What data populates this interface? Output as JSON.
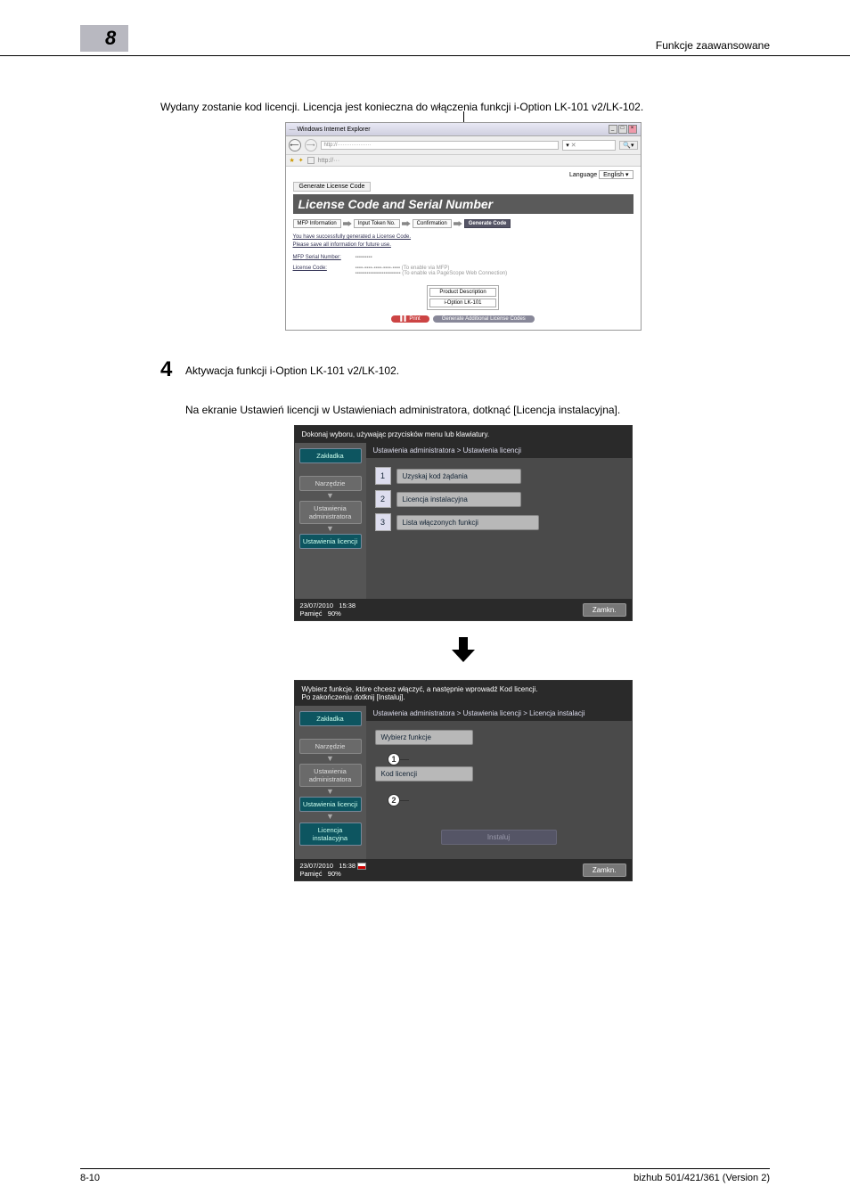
{
  "header": {
    "chapter_number": "8",
    "section_title": "Funkcje zaawansowane"
  },
  "intro": {
    "line": "Wydany zostanie kod licencji. Licencja jest konieczna do włączenia funkcji i-Option LK-101 v2/LK-102."
  },
  "browser": {
    "title_suffix": "Windows Internet Explorer",
    "language_label": "Language",
    "language_value": "English",
    "tab_label": "Generate License Code",
    "section_title": "License Code and Serial Number",
    "chain": {
      "s1": "MFP Information",
      "s2": "Input Token No.",
      "s3": "Confirmation",
      "s4": "Generate Code"
    },
    "success1": "You have successfully generated a License Code.",
    "success2": "Please save all information for future use.",
    "serial_label": "MFP Serial Number:",
    "license_label": "License Code:",
    "license_hint1": "(To enable via MFP)",
    "license_hint2": "(To enable via PageScope Web Connection)",
    "table_h": "Product Description",
    "table_v": "i-Option LK-101",
    "print": "Print",
    "gen_more": "Generate Additional License Codes"
  },
  "step4": {
    "num": "4",
    "text": "Aktywacja funkcji i-Option LK-101 v2/LK-102.",
    "sub": "Na ekranie Ustawień licencji w Ustawieniach administratora, dotknąć [Licencja instalacyjna]."
  },
  "panel1": {
    "instr": "Dokonaj wyboru, używając przycisków menu lub klawiatury.",
    "side": {
      "zakladka": "Zakładka",
      "narzedzie": "Narzędzie",
      "ustaw_admin": "Ustawienia administratora",
      "ustaw_lic": "Ustawienia licencji"
    },
    "crumb": "Ustawienia administratora  > Ustawienia licencji",
    "items": [
      {
        "n": "1",
        "label": "Uzyskaj kod żądania"
      },
      {
        "n": "2",
        "label": "Licencja instalacyjna"
      },
      {
        "n": "3",
        "label": "Lista włączonych funkcji"
      }
    ],
    "date": "23/07/2010",
    "time": "15:38",
    "mem_label": "Pamięć",
    "mem_val": "90%",
    "close": "Zamkn."
  },
  "panel2": {
    "instr1": "Wybierz funkcje, które chcesz włączyć, a następnie wprowadź Kod licencji.",
    "instr2": "Po zakończeniu dotknij [Instaluj].",
    "side": {
      "zakladka": "Zakładka",
      "narzedzie": "Narzędzie",
      "ustaw_admin": "Ustawienia administratora",
      "ustaw_lic": "Ustawienia licencji",
      "lic_inst": "Licencja instalacyjna"
    },
    "crumb": "Ustawienia administratora > Ustawienia licencji > Licencja instalacji",
    "btn1": "Wybierz funkcje",
    "btn2": "Kod licencji",
    "install": "Instaluj",
    "date": "23/07/2010",
    "time": "15:38",
    "mem_label": "Pamięć",
    "mem_val": "90%",
    "close": "Zamkn."
  },
  "callouts": {
    "c1": "1",
    "c2": "2"
  },
  "footer": {
    "page": "8-10",
    "product": "bizhub 501/421/361 (Version 2)"
  }
}
